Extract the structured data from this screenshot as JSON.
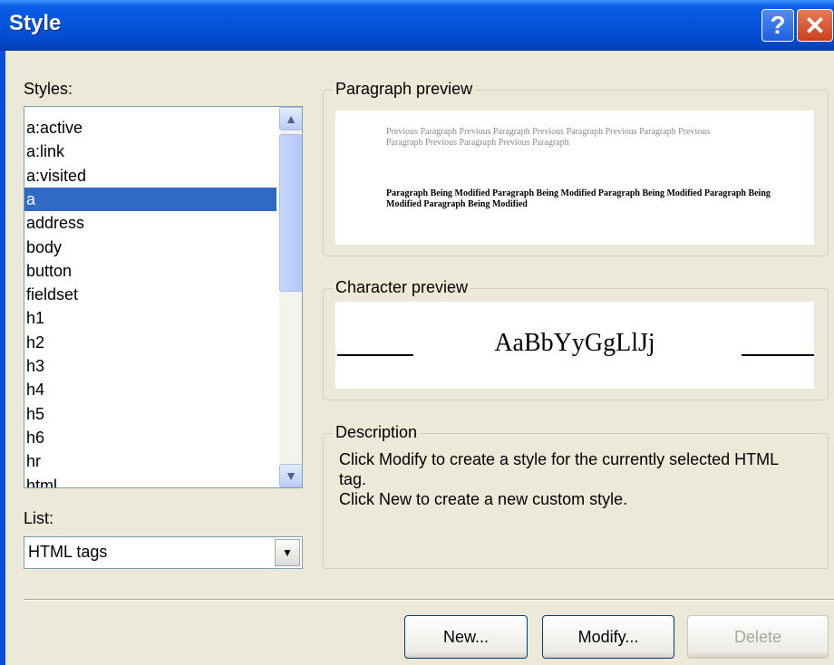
{
  "window": {
    "title": "Style"
  },
  "titlebar": {
    "help_glyph": "?",
    "close_glyph": "✕"
  },
  "styles_label": "Styles:",
  "styles_list": {
    "items": [
      "a:active",
      "a:link",
      "a:visited",
      "a",
      "address",
      "body",
      "button",
      "fieldset",
      "h1",
      "h2",
      "h3",
      "h4",
      "h5",
      "h6",
      "hr",
      "html"
    ],
    "selected": "a"
  },
  "list_label": "List:",
  "list_combo": {
    "value": "HTML tags"
  },
  "paragraph_preview": {
    "legend": "Paragraph preview",
    "previous_text": "Previous Paragraph Previous Paragraph Previous Paragraph Previous Paragraph Previous Paragraph Previous Paragraph Previous Paragraph",
    "modified_text": "Paragraph Being Modified Paragraph Being Modified Paragraph Being Modified Paragraph Being Modified Paragraph Being Modified"
  },
  "character_preview": {
    "legend": "Character preview",
    "sample": "AaBbYyGgLlJj"
  },
  "description": {
    "legend": "Description",
    "line1": "Click Modify to create a style for the currently selected HTML tag.",
    "line2": "Click New to create a new custom style."
  },
  "buttons": {
    "new": "New...",
    "modify": "Modify...",
    "delete": "Delete"
  },
  "colors": {
    "selection": "#316AC5",
    "dialog_bg": "#ECE9D8",
    "titlebar": "#0453D9"
  }
}
